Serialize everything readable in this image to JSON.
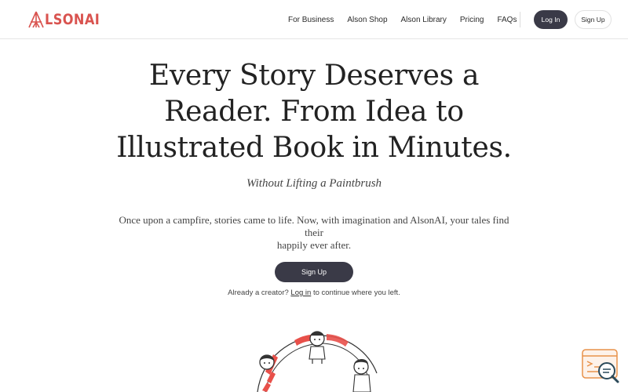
{
  "brand": {
    "logo_text": "LSONAI",
    "accent": "#d9534f"
  },
  "nav": {
    "items": [
      {
        "label": "For Business"
      },
      {
        "label": "Alson Shop"
      },
      {
        "label": "Alson Library"
      },
      {
        "label": "Pricing"
      },
      {
        "label": "FAQs"
      }
    ],
    "login_label": "Log In",
    "signup_label": "Sign Up"
  },
  "hero": {
    "title_lines": [
      "Every Story Deserves a",
      "Reader. From Idea to",
      "Illustrated Book in Minutes."
    ],
    "subtitle": "Without Lifting a Paintbrush",
    "description_lines": [
      "Once upon a campfire, stories came to life. Now, with imagination and AlsonAI, your tales find their",
      "happily ever after."
    ],
    "cta_label": "Sign Up",
    "creator_prefix": "Already a creator?",
    "creator_link": "Log in",
    "creator_suffix": "to continue where you left."
  },
  "colors": {
    "dark_button": "#3a3a47",
    "illustration_red": "#e8504a"
  },
  "icons": {
    "chat_widget": "chat-search-icon"
  }
}
